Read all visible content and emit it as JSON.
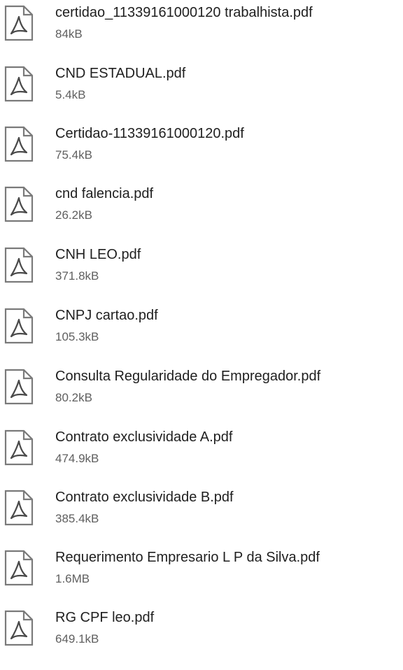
{
  "icon": "pdf-document-icon",
  "colors": {
    "text": "#1f1f1f",
    "secondary_text": "#5f5f5f",
    "icon_outline": "#7a7a7a"
  },
  "files": [
    {
      "name": "certidao_11339161000120 trabalhista.pdf",
      "size": "84kB"
    },
    {
      "name": "CND ESTADUAL.pdf",
      "size": "5.4kB"
    },
    {
      "name": "Certidao-11339161000120.pdf",
      "size": "75.4kB"
    },
    {
      "name": "cnd falencia.pdf",
      "size": "26.2kB"
    },
    {
      "name": "CNH LEO.pdf",
      "size": "371.8kB"
    },
    {
      "name": "CNPJ cartao.pdf",
      "size": "105.3kB"
    },
    {
      "name": "Consulta Regularidade do Empregador.pdf",
      "size": "80.2kB"
    },
    {
      "name": "Contrato exclusividade A.pdf",
      "size": "474.9kB"
    },
    {
      "name": "Contrato exclusividade B.pdf",
      "size": "385.4kB"
    },
    {
      "name": "Requerimento Empresario L P da Silva.pdf",
      "size": "1.6MB"
    },
    {
      "name": "RG CPF leo.pdf",
      "size": "649.1kB"
    }
  ]
}
